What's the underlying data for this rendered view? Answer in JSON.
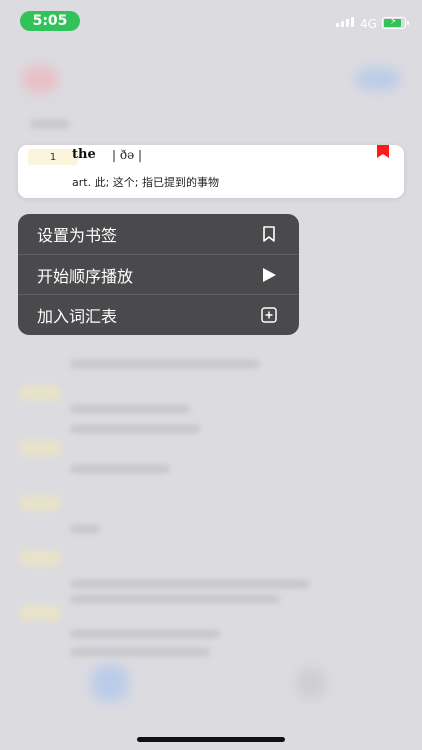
{
  "status_bar": {
    "time": "5:05",
    "network": "4G"
  },
  "word_card": {
    "index": "1",
    "word": "the",
    "phonetic": "| ðə |",
    "definition": "art. 此; 这个; 指已提到的事物",
    "bookmark_color": "#ff1a1a"
  },
  "context_menu": {
    "items": [
      {
        "label": "设置为书签",
        "icon": "bookmark-icon"
      },
      {
        "label": "开始顺序播放",
        "icon": "play-icon"
      },
      {
        "label": "加入词汇表",
        "icon": "add-square-icon"
      }
    ]
  },
  "colors": {
    "accent_green": "#31c35a",
    "menu_bg": "#4a4a4c",
    "badge_bg": "#fbf3dc"
  }
}
